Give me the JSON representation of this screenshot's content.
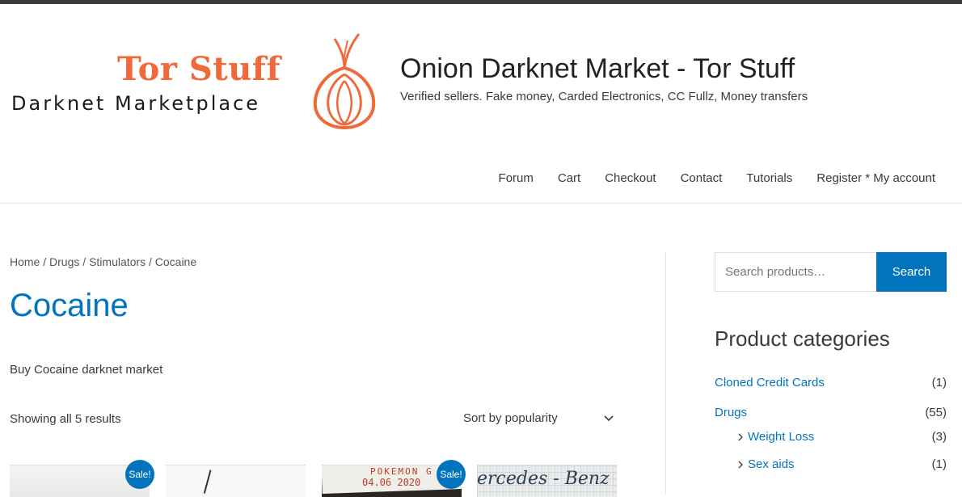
{
  "site": {
    "logo_title": "Tor Stuff",
    "logo_subtitle": "Darknet Marketplace",
    "title": "Onion Darknet Market - Tor Stuff",
    "description": "Verified sellers. Fake money, Carded Electronics, CC Fullz, Money transfers"
  },
  "nav": {
    "items": [
      "Forum",
      "Cart",
      "Checkout",
      "Contact",
      "Tutorials",
      "Register * My account"
    ]
  },
  "breadcrumb": {
    "home": "Home",
    "sep1": " / ",
    "drugs": "Drugs",
    "sep2": " / ",
    "stimulators": "Stimulators",
    "current": " / Cocaine"
  },
  "page": {
    "title": "Cocaine",
    "description": "Buy Cocaine darknet market",
    "result_count": "Showing all 5 results",
    "sort_value": "Sort by popularity"
  },
  "products": {
    "sale_badge": "Sale!",
    "p3_note_line1": "POKEMON G",
    "p3_note_line2": "04.06 2020",
    "p4_note": "ercedes - Benz"
  },
  "sidebar": {
    "search_placeholder": "Search products…",
    "search_button": "Search",
    "categories_title": "Product categories",
    "categories": [
      {
        "label": "Cloned Credit Cards",
        "count": "(1)"
      },
      {
        "label": "Drugs",
        "count": "(55)"
      },
      {
        "label": "Weight Loss",
        "count": "(3)"
      },
      {
        "label": "Sex aids",
        "count": "(1)"
      }
    ]
  },
  "colors": {
    "accent": "#0274be",
    "logo_orange": "#f0693a",
    "text": "#3a3a3a"
  }
}
